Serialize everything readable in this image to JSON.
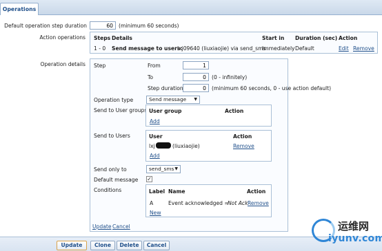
{
  "tabs": {
    "active": "Operations"
  },
  "step_duration": {
    "label": "Default operation step duration",
    "value": "60",
    "hint": "(minimum 60 seconds)"
  },
  "action_operations": {
    "label": "Action operations",
    "headers": [
      "Steps",
      "Details",
      "Start in",
      "Duration (sec)",
      "Action"
    ],
    "row": {
      "steps": "1 - 0",
      "details_bold": "Send message to users:",
      "details_rest": "lxj09640 (liuxiaojie) via send_sms",
      "start_in": "Immediately",
      "duration": "Default",
      "edit": "Edit",
      "remove": "Remove"
    }
  },
  "operation_details": {
    "label": "Operation details",
    "step_label": "Step",
    "from_label": "From",
    "from_value": "1",
    "to_label": "To",
    "to_value": "0",
    "to_hint": "(0 - infinitely)",
    "step_duration_label": "Step duration",
    "step_duration_value": "0",
    "step_duration_hint": "(minimum 60 seconds, 0 - use action default)",
    "operation_type_label": "Operation type",
    "operation_type_value": "Send message",
    "send_to_groups_label": "Send to User groups",
    "groups_headers": [
      "User group",
      "Action"
    ],
    "groups_add": "Add",
    "send_to_users_label": "Send to Users",
    "users_headers": [
      "User",
      "Action"
    ],
    "user_prefix": "lxj",
    "user_suffix": "(liuxiaojie)",
    "user_remove": "Remove",
    "users_add": "Add",
    "send_only_to_label": "Send only to",
    "send_only_to_value": "send_sms",
    "default_message_label": "Default message",
    "default_message_checked": true,
    "conditions_label": "Conditions",
    "conditions_headers": [
      "Label",
      "Name",
      "Action"
    ],
    "condition_label": "A",
    "condition_name_prefix": "Event acknowledged = ",
    "condition_name_value": "Not Ack",
    "condition_remove": "Remove",
    "conditions_new": "New",
    "update_link": "Update",
    "cancel_link": "Cancel"
  },
  "footer_buttons": {
    "update": "Update",
    "clone": "Clone",
    "delete": "Delete",
    "cancel": "Cancel"
  },
  "watermark": {
    "cn": "运维网",
    "en": "iyunv.com"
  }
}
